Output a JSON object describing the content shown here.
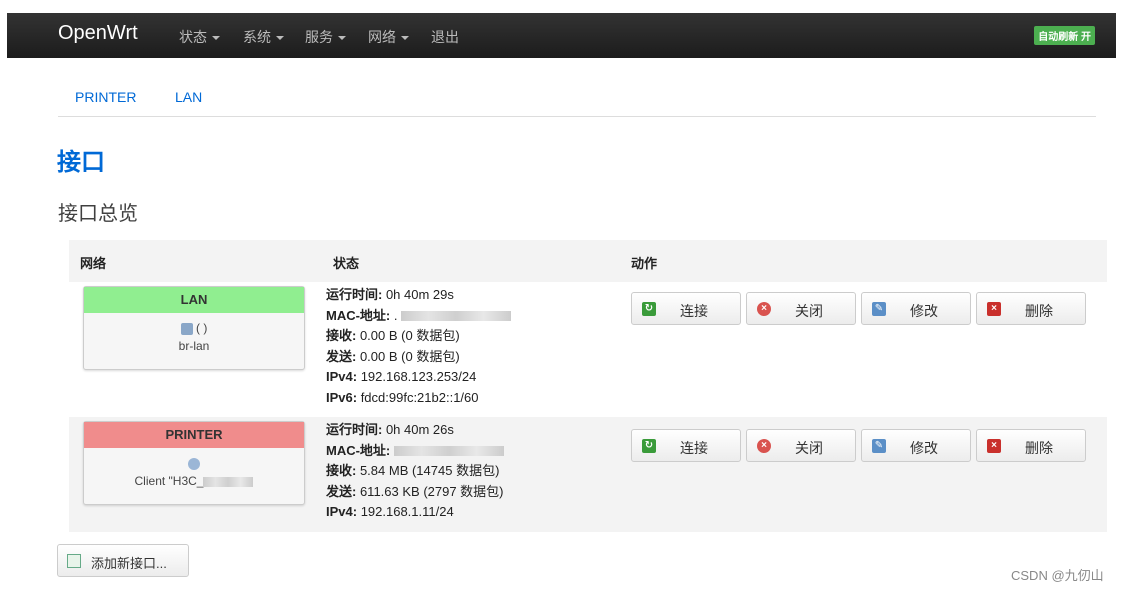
{
  "header": {
    "brand": "OpenWrt",
    "menu": [
      "状态",
      "系统",
      "服务",
      "网络",
      "退出"
    ],
    "autorefresh": "自动刷新 开"
  },
  "tabs": [
    "PRINTER",
    "LAN"
  ],
  "page": {
    "title": "接口",
    "subtitle": "接口总览"
  },
  "table": {
    "headers": [
      "网络",
      "状态",
      "动作"
    ],
    "rows": [
      {
        "name": "LAN",
        "color": "#90ee90",
        "icons": "(  )",
        "device": "br-lan",
        "status": [
          {
            "k": "运行时间:",
            "v": " 0h 40m 29s"
          },
          {
            "k": "MAC-地址:",
            "v": " ."
          },
          {
            "k": "接收:",
            "v": " 0.00 B (0 数据包)"
          },
          {
            "k": "发送:",
            "v": " 0.00 B (0 数据包)"
          },
          {
            "k": "IPv4:",
            "v": " 192.168.123.253/24"
          },
          {
            "k": "IPv6:",
            "v": " fdcd:99fc:21b2::1/60"
          }
        ]
      },
      {
        "name": "PRINTER",
        "color": "#f08c8c",
        "device": "Client \"H3C_",
        "status": [
          {
            "k": "运行时间:",
            "v": " 0h 40m 26s"
          },
          {
            "k": "MAC-地址:",
            "v": ""
          },
          {
            "k": "接收:",
            "v": " 5.84 MB (14745 数据包)"
          },
          {
            "k": "发送:",
            "v": " 611.63 KB (2797 数据包)"
          },
          {
            "k": "IPv4:",
            "v": " 192.168.1.11/24"
          }
        ]
      }
    ],
    "actions": [
      {
        "label": "连接",
        "icon": "reload-icon",
        "color": "#3a9b3a"
      },
      {
        "label": "关闭",
        "icon": "stop-icon",
        "color": "#d9534f"
      },
      {
        "label": "修改",
        "icon": "edit-icon",
        "color": "#5b8fc7"
      },
      {
        "label": "删除",
        "icon": "delete-icon",
        "color": "#c9302c"
      }
    ]
  },
  "add_button": "添加新接口...",
  "watermark": "CSDN @九仞山"
}
